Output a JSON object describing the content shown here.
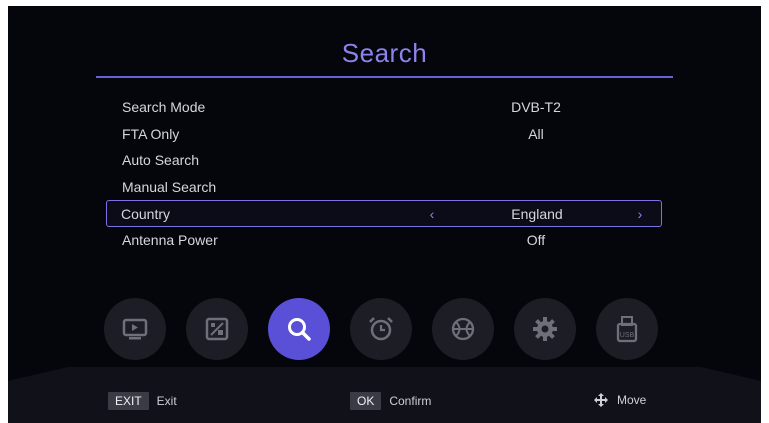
{
  "screen": {
    "title": "Search"
  },
  "menu": {
    "items": [
      {
        "label": "Search Mode",
        "value": "DVB-T2"
      },
      {
        "label": "FTA Only",
        "value": "All"
      },
      {
        "label": "Auto Search",
        "value": ""
      },
      {
        "label": "Manual Search",
        "value": ""
      },
      {
        "label": "Country",
        "value": "England",
        "selected": true
      },
      {
        "label": "Antenna Power",
        "value": "Off"
      }
    ],
    "arrow_left": "‹",
    "arrow_right": "›"
  },
  "nav_icons": [
    {
      "icon": "tv-icon"
    },
    {
      "icon": "picture-icon"
    },
    {
      "icon": "search-icon",
      "active": true
    },
    {
      "icon": "alarm-clock-icon"
    },
    {
      "icon": "ball-icon"
    },
    {
      "icon": "gear-icon"
    },
    {
      "icon": "usb-icon"
    }
  ],
  "footer": {
    "exit_key": "EXIT",
    "exit_label": "Exit",
    "ok_key": "OK",
    "ok_label": "Confirm",
    "move_label": "Move"
  },
  "colors": {
    "accent": "#7c72e4",
    "active_icon": "#5a50d8",
    "background": "#05060b"
  }
}
